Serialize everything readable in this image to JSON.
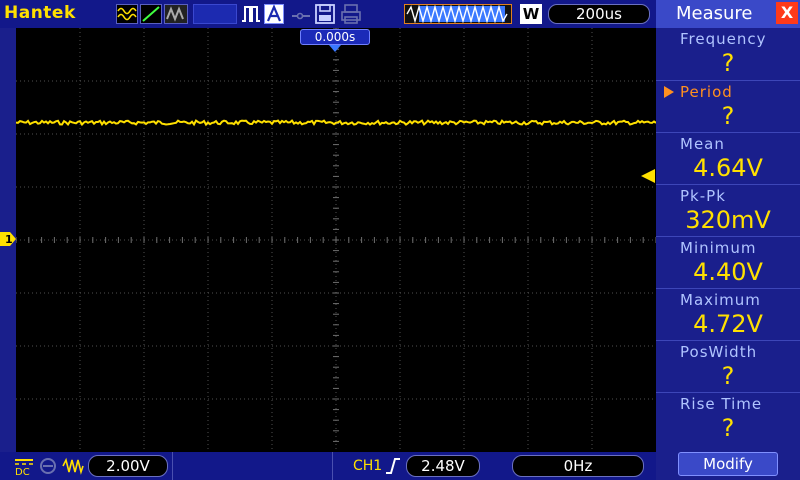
{
  "brand": "Hantek",
  "toolbar": {
    "timebase": "200us",
    "w_badge": "W"
  },
  "screen": {
    "trigger_position": "0.000s",
    "ch1_marker": "1"
  },
  "bottom": {
    "ch1_volt_div": "2.00V",
    "ch1_label": "CH1",
    "trigger_level": "2.48V",
    "frequency": "0Hz"
  },
  "measure": {
    "title": "Measure",
    "close": "X",
    "items": [
      {
        "label": "Frequency",
        "value": "?"
      },
      {
        "label": "Period",
        "value": "?"
      },
      {
        "label": "Mean",
        "value": "4.64V"
      },
      {
        "label": "Pk-Pk",
        "value": "320mV"
      },
      {
        "label": "Minimum",
        "value": "4.40V"
      },
      {
        "label": "Maximum",
        "value": "4.72V"
      },
      {
        "label": "PosWidth",
        "value": "?"
      },
      {
        "label": "Rise Time",
        "value": "?"
      }
    ],
    "modify_label": "Modify"
  },
  "colors": {
    "trace": "#ffe000",
    "accent": "#3a49c8",
    "background": "#1a1f8c"
  }
}
